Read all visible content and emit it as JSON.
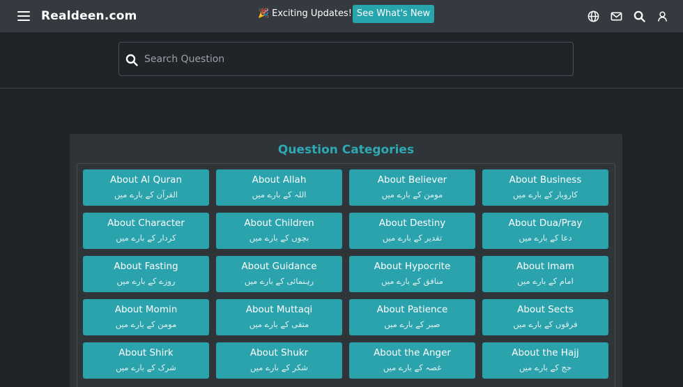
{
  "header": {
    "brand": "Realdeen.com",
    "updates_text": "Exciting Updates!",
    "updates_icon": "party-popper-icon",
    "see_new_label": "See What's New",
    "icons": [
      "globe-icon",
      "mail-icon",
      "search-icon",
      "user-icon"
    ]
  },
  "search": {
    "placeholder": "Search Question"
  },
  "categories": {
    "title": "Question Categories",
    "items": [
      {
        "en": "About Al Quran",
        "ur": "القرآن کے بارے میں"
      },
      {
        "en": "About Allah",
        "ur": "اللہ کے بارے میں"
      },
      {
        "en": "About Believer",
        "ur": "مومن کے بارے میں"
      },
      {
        "en": "About Business",
        "ur": "کاروبار کے بارے میں"
      },
      {
        "en": "About Character",
        "ur": "کردار کے بارے میں"
      },
      {
        "en": "About Children",
        "ur": "بچوں کے بارے میں"
      },
      {
        "en": "About Destiny",
        "ur": "تقدیر کے بارے میں"
      },
      {
        "en": "About Dua/Pray",
        "ur": "دعا کے بارے میں"
      },
      {
        "en": "About Fasting",
        "ur": "روزے کے بارے میں"
      },
      {
        "en": "About Guidance",
        "ur": "رہنمائی کے بارے میں"
      },
      {
        "en": "About Hypocrite",
        "ur": "منافق کے بارے میں"
      },
      {
        "en": "About Imam",
        "ur": "امام کے بارے میں"
      },
      {
        "en": "About Momin",
        "ur": "مومن کے بارے میں"
      },
      {
        "en": "About Muttaqi",
        "ur": "متقی کے بارے میں"
      },
      {
        "en": "About Patience",
        "ur": "صبر کے بارے میں"
      },
      {
        "en": "About Sects",
        "ur": "فرقوں کے بارے میں"
      },
      {
        "en": "About Shirk",
        "ur": "شرک کے بارے میں"
      },
      {
        "en": "About Shukr",
        "ur": "شکر کے بارے میں"
      },
      {
        "en": "About the Anger",
        "ur": "غصہ کے بارے میں"
      },
      {
        "en": "About the Hajj",
        "ur": "حج کے بارے میں"
      }
    ]
  },
  "colors": {
    "accent": "#2ba3ad",
    "header_bg": "#353a40",
    "page_bg": "#202428",
    "panel_bg": "#2e3438"
  }
}
